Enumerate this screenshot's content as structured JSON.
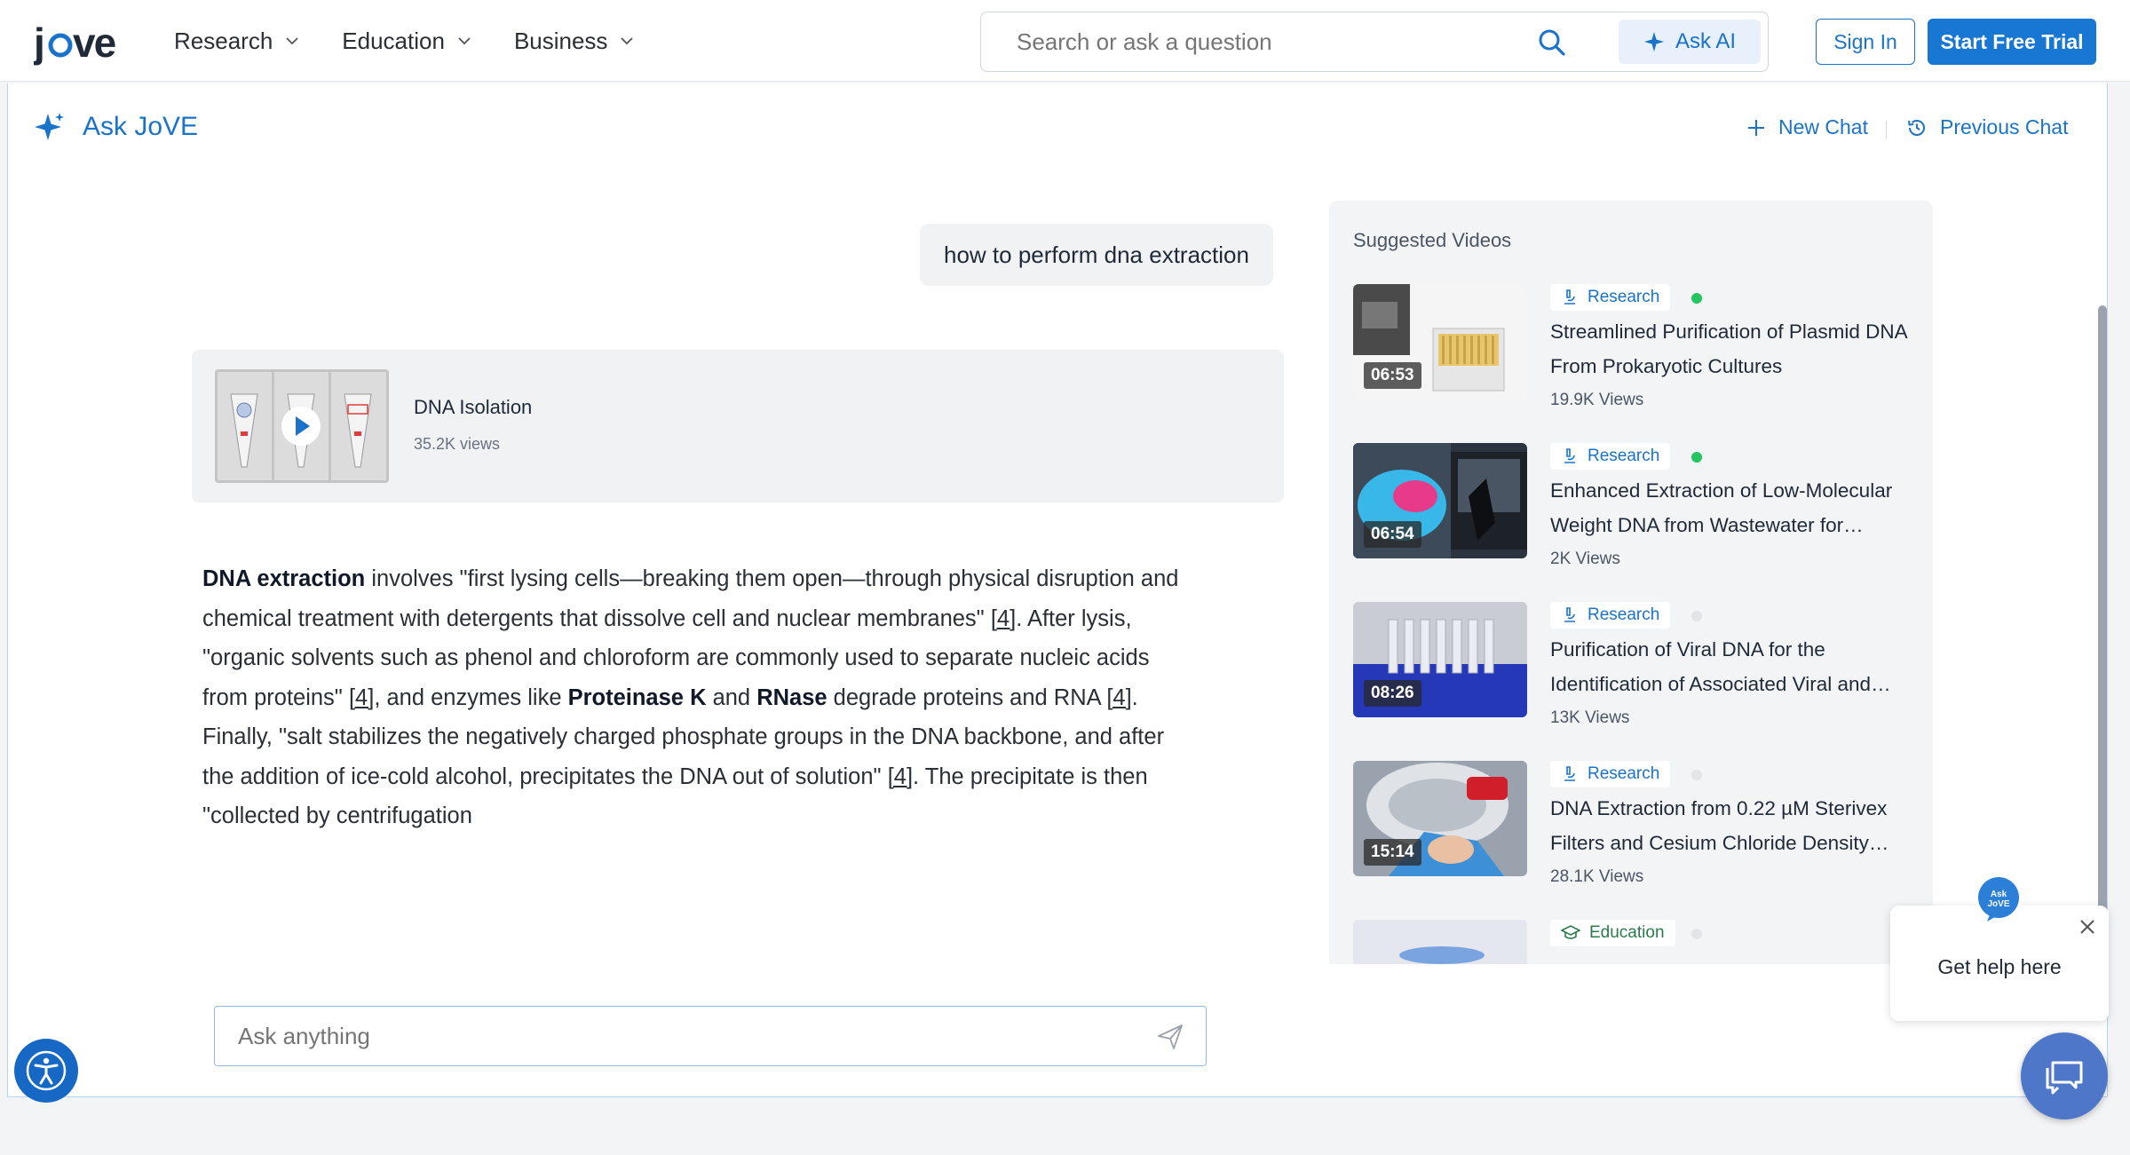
{
  "brand": {
    "logo": "jove",
    "accent": "#1a73c9"
  },
  "nav": {
    "items": [
      {
        "label": "Research"
      },
      {
        "label": "Education"
      },
      {
        "label": "Business"
      }
    ],
    "search_placeholder": "Search or ask a question",
    "ask_ai_label": "Ask AI",
    "sign_in_label": "Sign In",
    "trial_label": "Start Free Trial"
  },
  "chat": {
    "title": "Ask JoVE",
    "new_chat_label": "New Chat",
    "previous_chat_label": "Previous Chat",
    "user_message": "how to perform dna extraction",
    "video": {
      "title": "DNA Isolation",
      "views": "35.2K views"
    },
    "answer": {
      "term_dna": "DNA extraction",
      "s1": " involves \"first lysing cells—breaking them open—through physical disruption and chemical treatment with detergents that dissolve cell and nuclear membranes\" ",
      "ref": "[4]",
      "s2": ". After lysis, \"organic solvents such as phenol and chloroform are commonly used to separate nucleic acids from proteins\" ",
      "s3": ", and enzymes like ",
      "term_prok": "Proteinase K",
      "s4": " and ",
      "term_rnase": "RNase",
      "s5": " degrade proteins and RNA ",
      "s6": ". Finally, \"salt stabilizes the negatively charged phosphate groups in the DNA backbone, and after the addition of ice-cold alcohol, precipitates the DNA out of solution\" ",
      "s7": ". The precipitate is then \"collected by centrifugation"
    },
    "input_placeholder": "Ask anything"
  },
  "suggested": {
    "title": "Suggested Videos",
    "videos": [
      {
        "category": "Research",
        "active": true,
        "duration": "06:53",
        "title": "Streamlined Purification of Plasmid DNA From Prokaryotic Cultures",
        "views": "19.9K Views"
      },
      {
        "category": "Research",
        "active": true,
        "duration": "06:54",
        "title": "Enhanced Extraction of Low-Molecular Weight DNA from Wastewater for…",
        "views": "2K Views"
      },
      {
        "category": "Research",
        "active": false,
        "duration": "08:26",
        "title": "Purification of Viral DNA for the Identification of Associated Viral and…",
        "views": "13K Views"
      },
      {
        "category": "Research",
        "active": false,
        "duration": "15:14",
        "title": "DNA Extraction from 0.22 µM Sterivex Filters and Cesium Chloride Density…",
        "views": "28.1K Views"
      },
      {
        "category": "Education",
        "active": false,
        "duration": "",
        "title": "",
        "views": ""
      }
    ]
  },
  "help": {
    "text": "Get help here",
    "bubble_label": "Ask JoVE"
  }
}
